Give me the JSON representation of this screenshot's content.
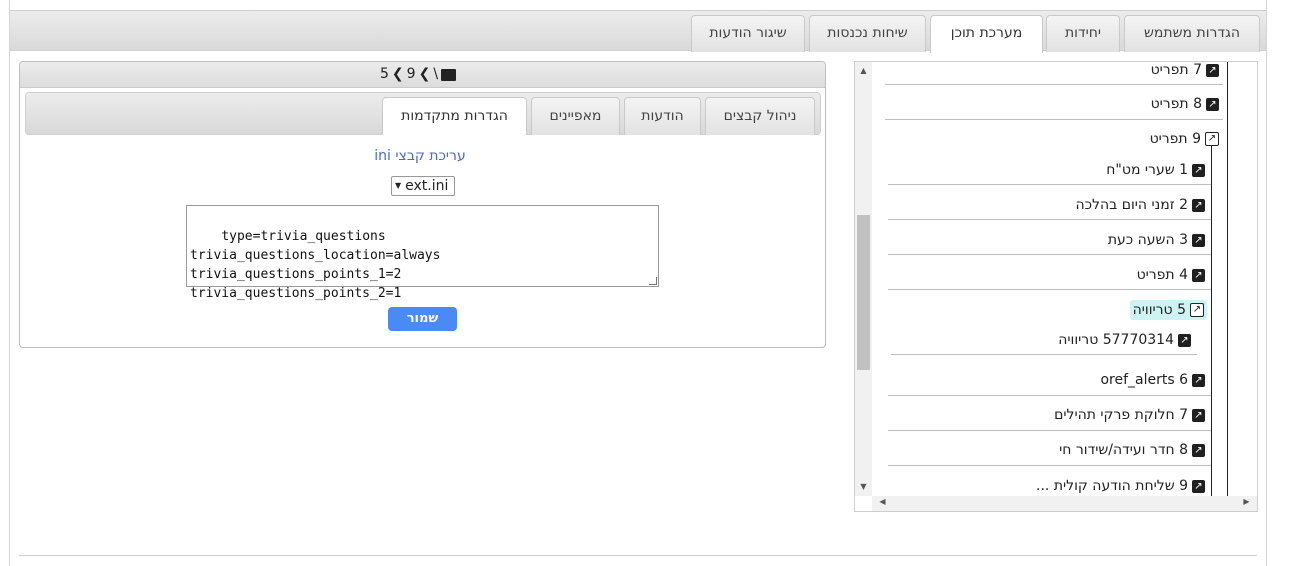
{
  "main_tabs": [
    {
      "label": "הגדרות משתמש",
      "active": false
    },
    {
      "label": "יחידות",
      "active": false
    },
    {
      "label": "מערכת תוכן",
      "active": true
    },
    {
      "label": "שיחות נכנסות",
      "active": false
    },
    {
      "label": "שיגור הודעות",
      "active": false
    }
  ],
  "breadcrumb": {
    "home_icon": "archive-icon",
    "sep": "\\",
    "level1": "9",
    "level2": "5"
  },
  "sub_tabs": [
    {
      "label": "ניהול קבצים",
      "active": false
    },
    {
      "label": "הודעות",
      "active": false
    },
    {
      "label": "מאפיינים",
      "active": false
    },
    {
      "label": "הגדרות מתקדמות",
      "active": true
    }
  ],
  "editor": {
    "link": "עריכת קבצי ini",
    "file_select": "ext.ini",
    "content": "type=trivia_questions\ntrivia_questions_location=always\ntrivia_questions_points_1=2\ntrivia_questions_points_2=1",
    "save_label": "שמור"
  },
  "tree": {
    "nodes": [
      {
        "label": "7 תפריט",
        "icon": "external-link-icon"
      },
      {
        "label": "8 תפריט",
        "icon": "external-link-icon"
      },
      {
        "label": "9 תפריט",
        "icon": "open-folder-icon"
      },
      {
        "label": "1 שערי מט\"ח",
        "icon": "external-link-icon"
      },
      {
        "label": "2 זמני היום בהלכה",
        "icon": "external-link-icon"
      },
      {
        "label": "3 השעה כעת",
        "icon": "external-link-icon"
      },
      {
        "label": "4 תפריט",
        "icon": "external-link-icon"
      },
      {
        "label": "5 טריוויה",
        "icon": "open-folder-icon",
        "selected": true
      },
      {
        "label": "57770314 טריוויה",
        "icon": "external-link-icon"
      },
      {
        "label": "oref_alerts 6",
        "icon": "external-link-icon"
      },
      {
        "label": "7 חלוקת פרקי תהילים",
        "icon": "external-link-icon"
      },
      {
        "label": "8 חדר ועידה/שידור חי",
        "icon": "external-link-icon"
      },
      {
        "label": "9 שליחת הודעה קולית ...",
        "icon": "external-link-icon"
      }
    ]
  },
  "colors": {
    "accent": "#4a8af4",
    "link": "#4a67c9",
    "selected_bg": "#cdf3f3"
  }
}
